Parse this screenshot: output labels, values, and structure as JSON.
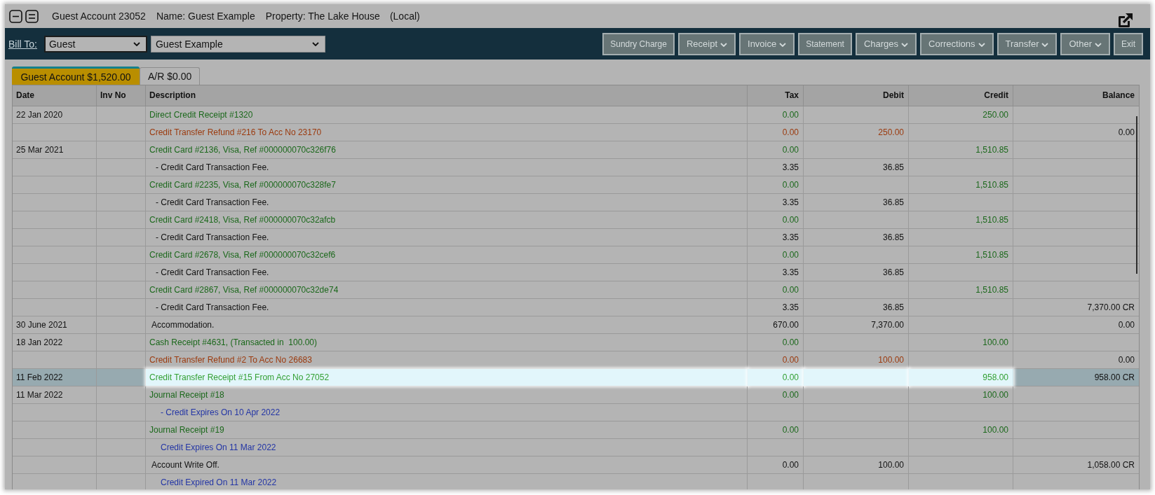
{
  "title_bar": {
    "account": "Guest Account 23052",
    "name": "Name: Guest Example",
    "property": "Property: The Lake House",
    "location": "(Local)"
  },
  "toolbar": {
    "bill_to_label": "Bill To:",
    "selects": [
      {
        "value": "Guest",
        "focused": true
      },
      {
        "value": "Guest Example",
        "focused": false
      }
    ],
    "buttons": [
      {
        "label": "Sundry Charge",
        "kind": "action"
      },
      {
        "label": "Receipt",
        "kind": "menu"
      },
      {
        "label": "Invoice",
        "kind": "menu"
      },
      {
        "label": "Statement",
        "kind": "action"
      },
      {
        "label": "Charges",
        "kind": "menu"
      },
      {
        "label": "Corrections",
        "kind": "menu"
      },
      {
        "label": "Transfer",
        "kind": "menu"
      },
      {
        "label": "Other",
        "kind": "menu"
      },
      {
        "label": "Exit",
        "kind": "action"
      }
    ]
  },
  "tabs": [
    {
      "label": "Guest Account $1,520.00",
      "selected": true
    },
    {
      "label": "A/R $0.00",
      "selected": false
    }
  ],
  "table": {
    "columns": [
      "Date",
      "Inv No",
      "Description",
      "Tax",
      "Debit",
      "Credit",
      "Balance"
    ],
    "rows": [
      {
        "date": "22 Jan 2020",
        "description": "Direct Credit Receipt #1320",
        "kind": "receipt",
        "tax": "0.00",
        "credit": "250.00",
        "selected": false
      },
      {
        "description": "Credit Transfer Refund #216 To Acc No 23170",
        "kind": "refund",
        "tax": "0.00",
        "debit": "250.00",
        "balance": "0.00",
        "selected": false
      },
      {
        "date": "25 Mar 2021",
        "description": "Credit Card #2136, Visa, Ref #000000070c326f76",
        "kind": "receipt",
        "tax": "0.00",
        "credit": "1,510.85",
        "selected": false,
        "children": [
          {
            "description": "- Credit Card Transaction Fee.",
            "kind": "charge",
            "tax": "3.35",
            "debit": "36.85",
            "selected": false
          }
        ]
      },
      {
        "description": "Credit Card #2235, Visa, Ref #000000070c328fe7",
        "kind": "receipt",
        "tax": "0.00",
        "credit": "1,510.85",
        "selected": false,
        "children": [
          {
            "description": "- Credit Card Transaction Fee.",
            "kind": "charge",
            "tax": "3.35",
            "debit": "36.85",
            "selected": false
          }
        ]
      },
      {
        "description": "Credit Card #2418, Visa, Ref #000000070c32afcb",
        "kind": "receipt",
        "tax": "0.00",
        "credit": "1,510.85",
        "selected": false,
        "children": [
          {
            "description": "- Credit Card Transaction Fee.",
            "kind": "charge",
            "tax": "3.35",
            "debit": "36.85",
            "selected": false
          }
        ]
      },
      {
        "description": "Credit Card #2678, Visa, Ref #000000070c32cef6",
        "kind": "receipt",
        "tax": "0.00",
        "credit": "1,510.85",
        "selected": false,
        "children": [
          {
            "description": "- Credit Card Transaction Fee.",
            "kind": "charge",
            "tax": "3.35",
            "debit": "36.85",
            "selected": false
          }
        ]
      },
      {
        "description": "Credit Card #2867, Visa, Ref #000000070c32de74",
        "kind": "receipt",
        "tax": "0.00",
        "credit": "1,510.85",
        "selected": false,
        "children": [
          {
            "description": "- Credit Card Transaction Fee.",
            "kind": "charge",
            "tax": "3.35",
            "debit": "36.85",
            "balance": "7,370.00 CR",
            "selected": false
          }
        ]
      },
      {
        "date": "30 June 2021",
        "description": "Accommodation.",
        "kind": "charge",
        "tax": "670.00",
        "debit": "7,370.00",
        "balance": "0.00",
        "selected": false
      },
      {
        "date": "18 Jan 2022",
        "description": "Cash Receipt #4631, (Transacted in  100.00)",
        "kind": "receipt",
        "tax": "0.00",
        "credit": "100.00",
        "selected": false
      },
      {
        "description": "Credit Transfer Refund #2 To Acc No 26683",
        "kind": "refund",
        "tax": "0.00",
        "debit": "100.00",
        "balance": "0.00",
        "selected": false
      },
      {
        "date": "11 Feb 2022",
        "description": "Credit Transfer Receipt #15 From Acc No 27052",
        "kind": "receipt",
        "tax": "0.00",
        "credit": "958.00",
        "balance": "958.00 CR",
        "selected": true
      },
      {
        "date": "11 Mar 2022",
        "description": "Journal Receipt #18",
        "kind": "receipt",
        "tax": "0.00",
        "credit": "100.00",
        "selected": false,
        "children": [
          {
            "description": "- Credit Expires On 10 Apr 2022",
            "kind": "note",
            "selected": false
          }
        ]
      },
      {
        "description": "Journal Receipt #19",
        "kind": "receipt",
        "tax": "0.00",
        "credit": "100.00",
        "selected": false,
        "children": [
          {
            "description": "Credit Expires On 11 Mar 2022",
            "kind": "note",
            "selected": false
          }
        ]
      },
      {
        "description": "Account Write Off.",
        "kind": "charge",
        "tax": "0.00",
        "debit": "100.00",
        "balance": "1,058.00 CR",
        "selected": false,
        "children": [
          {
            "description": "Credit Expired On 11 Mar 2022",
            "kind": "note",
            "selected": false
          }
        ]
      }
    ]
  }
}
